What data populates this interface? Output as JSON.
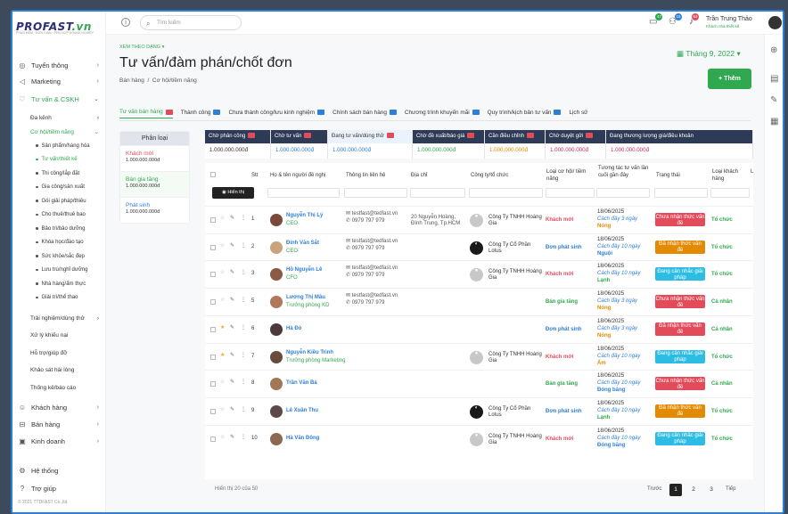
{
  "brand": {
    "logo_main": "PROFAST",
    "logo_suffix": ".vn",
    "tagline": "PHẦN MỀM · ĐƠN GIẢN · PHÙ HỢP DOANH NGHIỆP"
  },
  "sidebar": {
    "items": [
      {
        "label": "Tuyển thông",
        "icon": "globe-icon"
      },
      {
        "label": "Marketing",
        "icon": "megaphone-icon"
      },
      {
        "label": "Tư vấn & CSKH",
        "icon": "heart-icon"
      }
    ],
    "tuvan_subs": [
      "Đa kênh",
      "Cơ hội/tiềm năng"
    ],
    "cohoi_children": [
      "Sản phẩm/hàng hóa",
      "Tư vấn/thiết kế",
      "Thi công/lắp đặt",
      "Gia công/sản xuất",
      "Gói giải pháp/thiêu",
      "Cho thuê/thuê bao",
      "Bảo trì/bảo dưỡng",
      "Khóa học/đào tạo",
      "Sức khỏe/sắc đẹp",
      "Lưu trú/nghỉ dưỡng",
      "Nhà hàng/ẩm thực",
      "Giải trí/thể thao"
    ],
    "more_subs": [
      "Trải nghiệm/dùng thử",
      "Xử lý khiếu nại",
      "Hỗ trợ/giúp đỡ",
      "Khảo sát hài lòng",
      "Thống kê/báo cáo"
    ],
    "bottom": [
      {
        "label": "Khách hàng",
        "icon": "users-icon"
      },
      {
        "label": "Bán hàng",
        "icon": "cart-icon"
      },
      {
        "label": "Kinh doanh",
        "icon": "briefcase-icon"
      }
    ],
    "system": "Hệ thống",
    "help": "Trợ giúp",
    "copyright": "© 2021 TTDFAST Co.,ltd"
  },
  "topbar": {
    "search_placeholder": "Tìm kiếm",
    "badges": {
      "chat": "47",
      "group": "15",
      "bell": "62"
    },
    "user_name": "Trần Trung Thảo",
    "user_role": "Khách nhà thiết kế"
  },
  "page": {
    "view_by": "XEM THEO DẠNG",
    "title": "Tư vấn/đàm phán/chốt đơn",
    "crumb_1": "Bán hàng",
    "crumb_sep": "/",
    "crumb_2": "Cơ hội/tiềm năng",
    "month": "Tháng 9, 2022",
    "add_button": "+ Thêm"
  },
  "tabs": [
    {
      "label": "Tư vấn bán hàng",
      "badge": "red",
      "active": true
    },
    {
      "label": "Thành công",
      "badge": "blue"
    },
    {
      "label": "Chưa thành công/lưu kinh nghiệm",
      "badge": "blue"
    },
    {
      "label": "Chính sách bán hàng",
      "badge": "blue"
    },
    {
      "label": "Chương trình khuyến mãi",
      "badge": "blue"
    },
    {
      "label": "Quy trình/kịch bản tư vấn",
      "badge": "blue"
    },
    {
      "label": "Lịch sử",
      "badge": ""
    }
  ],
  "phanloai": {
    "header": "Phân loại",
    "rows": [
      {
        "label": "Khách mới",
        "value": "1.000.000.000đ",
        "color": "#e44b5a"
      },
      {
        "label": "Bán gia tăng",
        "value": "1.000.000.000đ",
        "color": "#2fa84f"
      },
      {
        "label": "Phát sinh",
        "value": "1.000.000.000đ",
        "color": "#2d7fd8"
      }
    ]
  },
  "stages": [
    {
      "label": "Chờ phân công",
      "value": "1.000.000.000đ",
      "vcolor": "#333"
    },
    {
      "label": "Chờ tư vấn",
      "value": "1.000.000.000đ",
      "vcolor": "#2d7fd8"
    },
    {
      "label": "Đang tư vấn/dùng thử",
      "value": "1.000.000.000đ",
      "vcolor": "#2d7fd8",
      "sel": true
    },
    {
      "label": "Chờ đề xuất/báo giá",
      "value": "1.000.000.000đ",
      "vcolor": "#2fa84f"
    },
    {
      "label": "Cần điều chỉnh",
      "value": "1.000.000.000đ",
      "vcolor": "#e48a00"
    },
    {
      "label": "Chờ duyệt gửi",
      "value": "1.000.000.000đ",
      "vcolor": "#c62d6a"
    },
    {
      "label": "Đang thương lượng giá/điều khoản",
      "value": "1.000.000.000đ",
      "vcolor": "#c62d6a"
    }
  ],
  "table": {
    "show_button": "Hiển thị",
    "headers": {
      "stt": "Stt",
      "name": "Họ & tên người đề nghị",
      "contact": "Thông tin liên hệ",
      "address": "Địa chỉ",
      "company": "Công ty/tổ chức",
      "oppo": "Loại cơ hội/ tiềm năng",
      "last": "Tương tác tư vấn lần cuối gần đây",
      "status": "Trạng thái",
      "cust": "Loại khách hàng",
      "extra": "L"
    },
    "rows": [
      {
        "stt": "1",
        "star": false,
        "name": "Nguyễn Thị Lý",
        "role": "CEO",
        "email": "testfast@tedfast.vn",
        "phone": "0979 797 979",
        "addr": "20 Nguyễn Hoàng, Đình Trung, Tp.HCM",
        "company": "Công Ty TNHH Hoàng Gia",
        "logo": "gold",
        "oppo": "Khách mới",
        "oppo_color": "#e44b5a",
        "date": "18/06/2025",
        "ago": "Cách đây 3 ngày",
        "level": "Nóng",
        "level_color": "#e48a00",
        "status": "Chưa nhận thức vấn đề",
        "status_color": "#e44b5a",
        "cust": "Tổ chức"
      },
      {
        "stt": "2",
        "star": false,
        "name": "Đinh Văn Sắt",
        "role": "CEO",
        "email": "testfast@tedfast.vn",
        "phone": "0979 797 979",
        "addr": "",
        "company": "Công Ty Cổ Phần Lotus",
        "logo": "dark",
        "oppo": "Đơn phát sinh",
        "oppo_color": "#2d7fd8",
        "date": "18/06/2025",
        "ago": "Cách đây 10 ngày",
        "level": "Nguội",
        "level_color": "#2d7fd8",
        "status": "Đã nhận thức vấn đề",
        "status_color": "#e48a00",
        "cust": "Tổ chức"
      },
      {
        "stt": "3",
        "star": false,
        "name": "Hồ Nguyễn Lê",
        "role": "CFO",
        "email": "testfast@tedfast.vn",
        "phone": "0979 797 979",
        "addr": "",
        "company": "Công Ty TNHH Hoàng Gia",
        "logo": "gold",
        "oppo": "Khách mới",
        "oppo_color": "#e44b5a",
        "date": "18/06/2025",
        "ago": "Cách đây 10 ngày",
        "level": "Lạnh",
        "level_color": "#2fa84f",
        "status": "Đang cân nhắc giải pháp",
        "status_color": "#2dbde4",
        "cust": "Tổ chức"
      },
      {
        "stt": "5",
        "star": false,
        "name": "Lương Thị Mâu",
        "role": "Trưởng phòng KD",
        "email": "testfast@tedfast.vn",
        "phone": "0979 797 979",
        "addr": "",
        "company": "",
        "logo": "",
        "oppo": "Bán gia tăng",
        "oppo_color": "#2fa84f",
        "date": "18/06/2025",
        "ago": "Cách đây 3 ngày",
        "level": "Nóng",
        "level_color": "#e48a00",
        "status": "Chưa nhận thức vấn đề",
        "status_color": "#e44b5a",
        "cust": "Cá nhân"
      },
      {
        "stt": "6",
        "star": true,
        "name": "Hà Đỏ",
        "role": "",
        "email": "",
        "phone": "",
        "addr": "",
        "company": "",
        "logo": "",
        "oppo": "Đơn phát sinh",
        "oppo_color": "#2d7fd8",
        "date": "18/06/2025",
        "ago": "Cách đây 3 ngày",
        "level": "Nóng",
        "level_color": "#e48a00",
        "status": "Đã nhận thức vấn đề",
        "status_color": "#e44b5a",
        "cust": "Cá nhân"
      },
      {
        "stt": "7",
        "star": true,
        "name": "Nguyễn Kiều Trinh",
        "role": "Trưởng phòng Marketing",
        "email": "",
        "phone": "",
        "addr": "",
        "company": "Công Ty TNHH Hoàng Gia",
        "logo": "gold",
        "oppo": "Khách mới",
        "oppo_color": "#e44b5a",
        "date": "18/06/2025",
        "ago": "Cách đây 10 ngày",
        "level": "Ấm",
        "level_color": "#e48a00",
        "status": "Đang cân nhắc giải pháp",
        "status_color": "#2dbde4",
        "cust": "Tổ chức"
      },
      {
        "stt": "8",
        "star": false,
        "name": "Trần Văn Bá",
        "role": "",
        "email": "",
        "phone": "",
        "addr": "",
        "company": "",
        "logo": "",
        "oppo": "Bán gia tăng",
        "oppo_color": "#2fa84f",
        "date": "18/06/2025",
        "ago": "Cách đây 10 ngày",
        "level": "Đóng băng",
        "level_color": "#2d7fd8",
        "status": "Chưa nhận thức vấn đề",
        "status_color": "#e44b5a",
        "cust": "Cá nhân"
      },
      {
        "stt": "9",
        "star": false,
        "name": "Lê Xuân Thu",
        "role": "",
        "email": "",
        "phone": "",
        "addr": "",
        "company": "Công Ty Cổ Phần Lotus",
        "logo": "dark",
        "oppo": "Đơn phát sinh",
        "oppo_color": "#2d7fd8",
        "date": "18/06/2025",
        "ago": "Cách đây 10 ngày",
        "level": "Lạnh",
        "level_color": "#2fa84f",
        "status": "Đã nhận thức vấn đề",
        "status_color": "#e48a00",
        "cust": "Tổ chức"
      },
      {
        "stt": "10",
        "star": false,
        "name": "Hà Văn Đông",
        "role": "",
        "email": "",
        "phone": "",
        "addr": "",
        "company": "Công Ty TNHH Hoàng Gia",
        "logo": "gold",
        "oppo": "Khách mới",
        "oppo_color": "#e44b5a",
        "date": "18/06/2025",
        "ago": "Cách đây 10 ngày",
        "level": "Đóng băng",
        "level_color": "#2d7fd8",
        "status": "Đang cân nhắc giải pháp",
        "status_color": "#2dbde4",
        "cust": "Tổ chức"
      }
    ],
    "footer": "Hiển thị 20 của 50",
    "prev": "Trước",
    "pages": [
      "1",
      "2",
      "3"
    ],
    "next": "Tiếp"
  }
}
